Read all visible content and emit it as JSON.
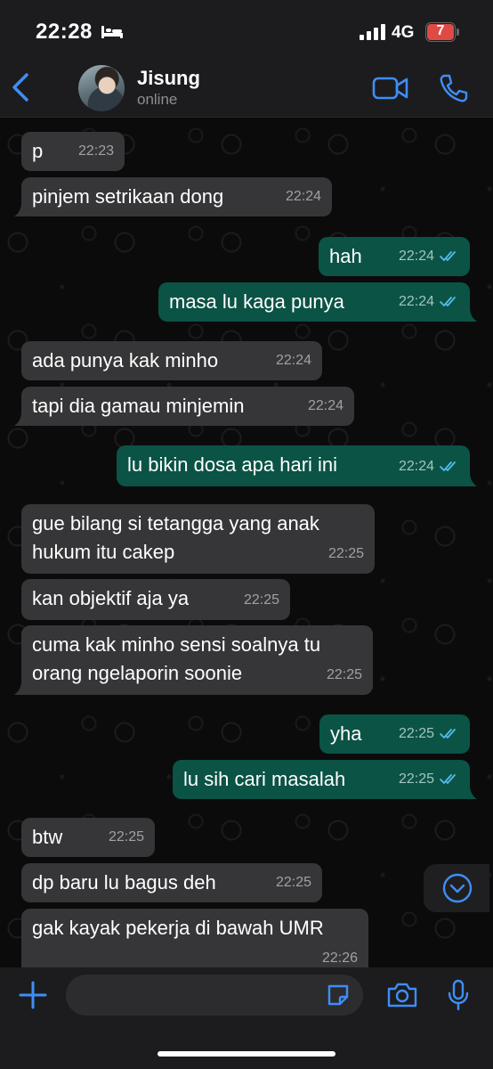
{
  "status_bar": {
    "time": "22:28",
    "network": "4G",
    "battery_percent": "7",
    "icons": [
      "bed-icon",
      "signal-icon",
      "battery-icon"
    ]
  },
  "header": {
    "contact_name": "Jisung",
    "contact_status": "online",
    "icons": [
      "back-chevron-icon",
      "video-call-icon",
      "phone-icon"
    ]
  },
  "colors": {
    "accent": "#3e8ef7",
    "incoming_bubble": "#363638",
    "outgoing_bubble": "#0b5345",
    "read_receipt": "#53bdeb",
    "battery_low": "#e04a44"
  },
  "messages": [
    {
      "dir": "in",
      "text": "p",
      "time": "22:23"
    },
    {
      "dir": "in",
      "text": "pinjem setrikaan dong",
      "time": "22:24"
    },
    {
      "dir": "out",
      "text": "hah",
      "time": "22:24",
      "status": "read"
    },
    {
      "dir": "out",
      "text": "masa lu kaga punya",
      "time": "22:24",
      "status": "read"
    },
    {
      "dir": "in",
      "text": "ada punya kak minho",
      "time": "22:24"
    },
    {
      "dir": "in",
      "text": "tapi dia gamau minjemin",
      "time": "22:24"
    },
    {
      "dir": "out",
      "text": "lu bikin dosa apa hari ini",
      "time": "22:24",
      "status": "read"
    },
    {
      "dir": "in",
      "text": "gue bilang si tetangga yang anak\nhukum itu cakep",
      "time": "22:25"
    },
    {
      "dir": "in",
      "text": "kan objektif aja ya",
      "time": "22:25"
    },
    {
      "dir": "in",
      "text": "cuma kak minho sensi soalnya tu\norang ngelaporin soonie",
      "time": "22:25"
    },
    {
      "dir": "out",
      "text": "yha",
      "time": "22:25",
      "status": "read"
    },
    {
      "dir": "out",
      "text": "lu sih cari masalah",
      "time": "22:25",
      "status": "read"
    },
    {
      "dir": "in",
      "text": "btw",
      "time": "22:25"
    },
    {
      "dir": "in",
      "text": "dp baru lu bagus deh",
      "time": "22:25"
    },
    {
      "dir": "in",
      "text": "gak kayak pekerja di bawah UMR",
      "time": "22:26"
    }
  ],
  "input_bar": {
    "placeholder": "",
    "icons": [
      "plus-icon",
      "sticker-icon",
      "camera-icon",
      "microphone-icon"
    ]
  },
  "scroll_down_icon": "chevron-down-circle-icon"
}
